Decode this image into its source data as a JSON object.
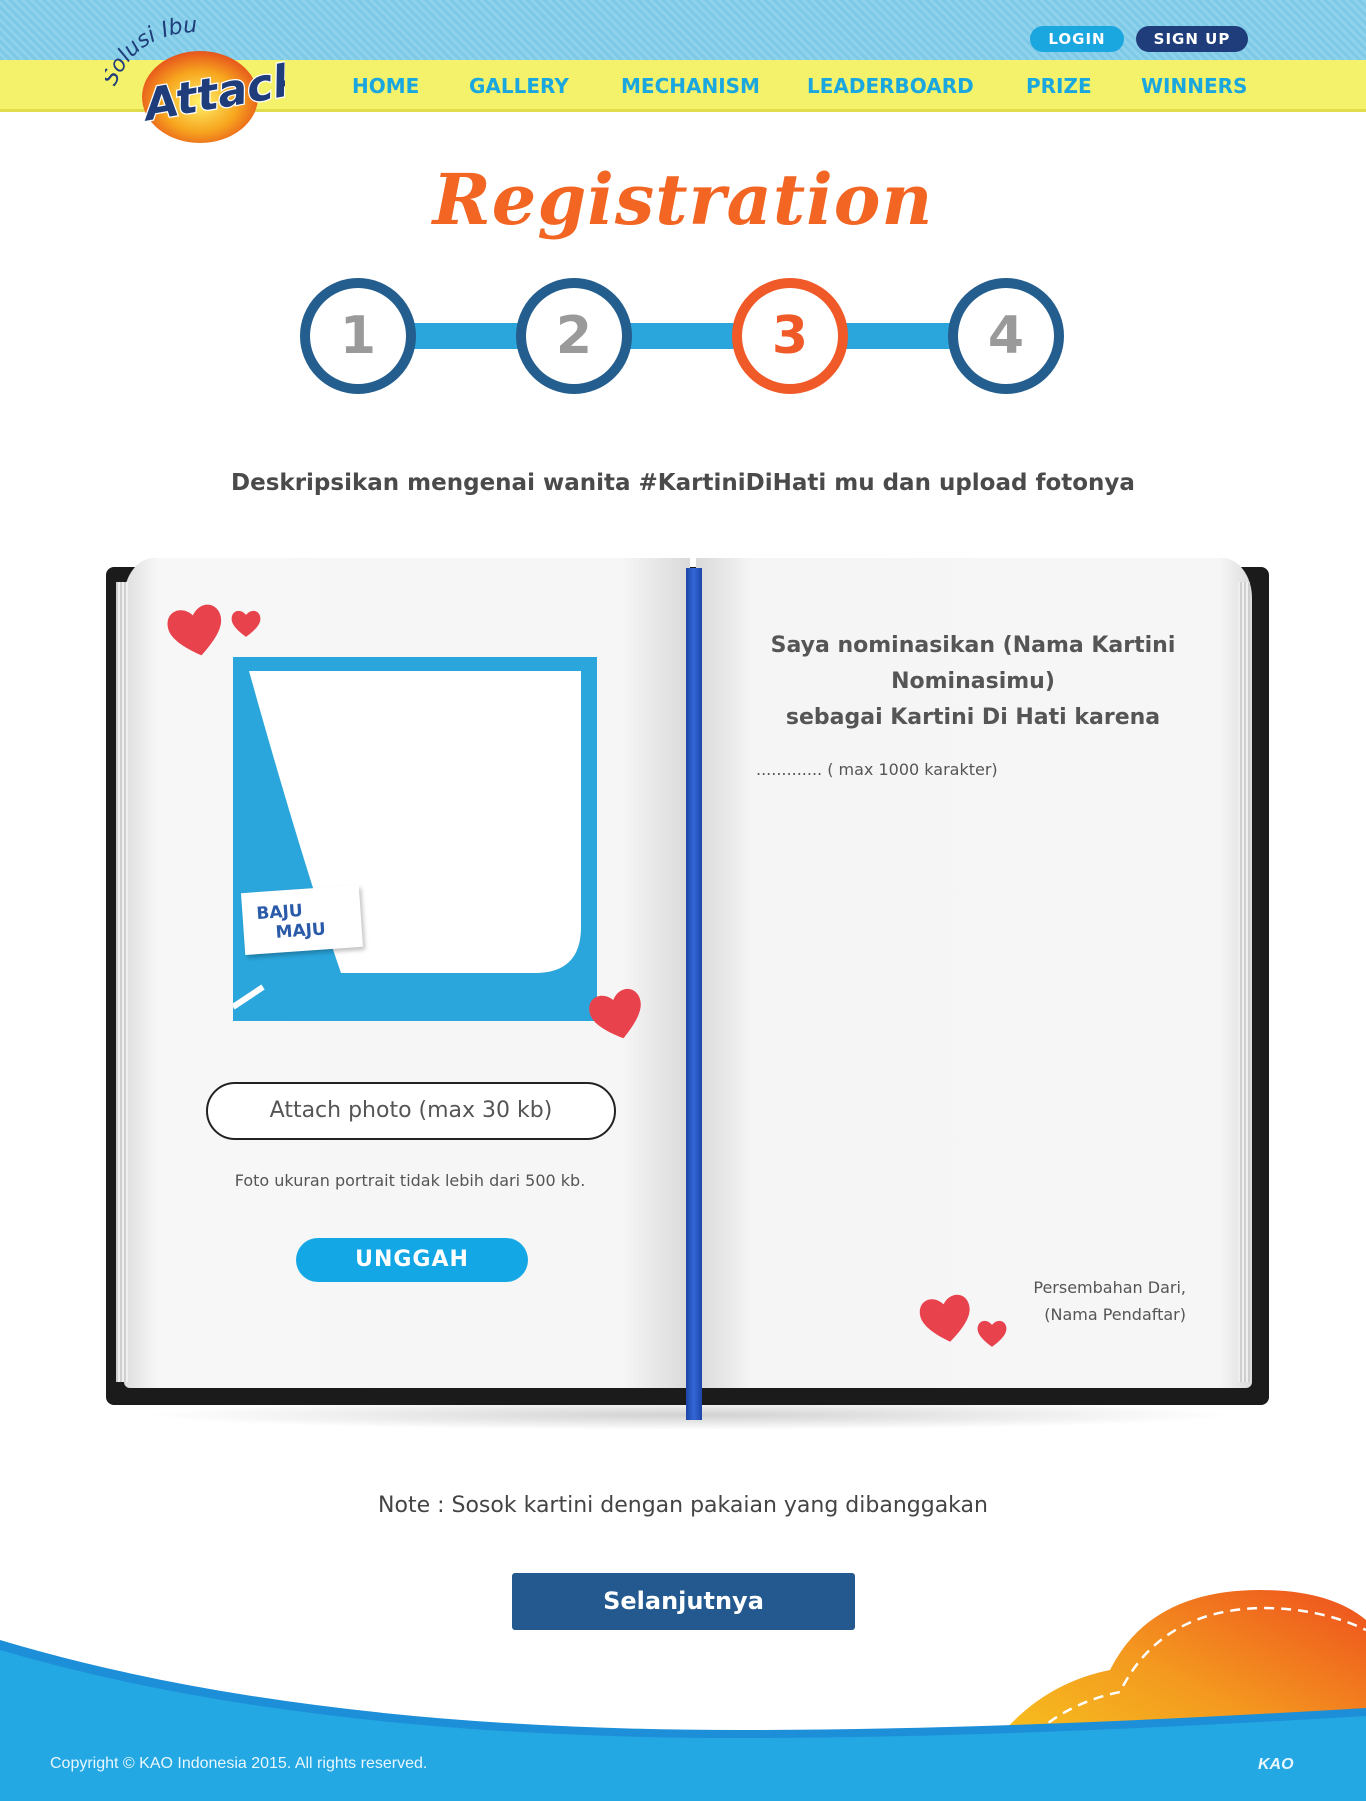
{
  "header": {
    "logo_top_text": "Solusi Ibu",
    "logo_brand": "Attack",
    "login": "LOGIN",
    "signup": "SIGN UP",
    "nav": [
      "HOME",
      "GALLERY",
      "MECHANISM",
      "LEADERBOARD",
      "PRIZE",
      "WINNERS"
    ]
  },
  "title": "Registration",
  "steps": {
    "labels": [
      "1",
      "2",
      "3",
      "4"
    ],
    "active": 3
  },
  "instruction": "Deskripsikan mengenai wanita #KartiniDiHati mu dan upload fotonya",
  "left_page": {
    "badge_text_1": "BAJU",
    "badge_text_2": "MAJU",
    "attach_label": "Attach photo (max 30 kb)",
    "photo_note": "Foto ukuran portrait tidak lebih dari 500 kb.",
    "upload_label": "UNGGAH"
  },
  "right_page": {
    "nominate_line1": "Saya nominasikan (Nama Kartini",
    "nominate_line2": "Nominasimu)",
    "nominate_line3": "sebagai Kartini Di Hati karena",
    "input_placeholder": "............. ( max 1000 karakter)",
    "sign_line1": "Persembahan Dari,",
    "sign_line2": "(Nama Pendaftar)"
  },
  "note": "Note : Sosok kartini dengan pakaian yang dibanggakan",
  "next_button": "Selanjutnya",
  "footer": {
    "copyright": "Copyright © KAO Indonesia 2015. All rights reserved.",
    "kao": "KAO"
  },
  "colors": {
    "accent_orange": "#f05a28",
    "nav_blue": "#1aa6df",
    "dark_blue": "#23598f",
    "nav_yellow": "#f4f16a"
  }
}
